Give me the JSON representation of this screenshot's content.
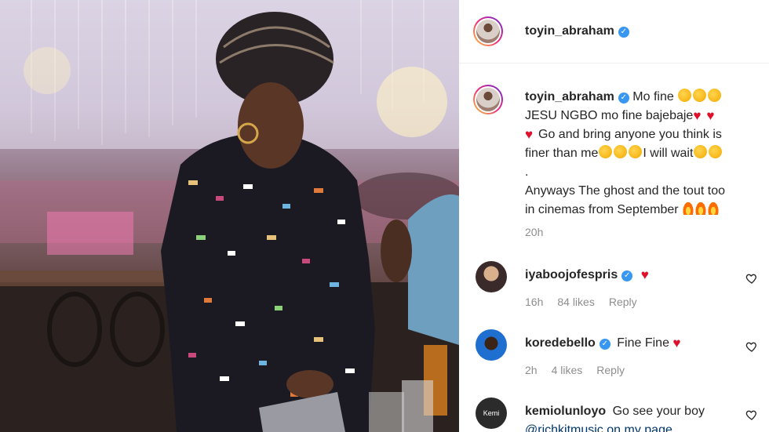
{
  "post": {
    "author": "toyin_abraham",
    "caption_lines": [
      "Mo fine",
      "JESU NGBO mo fine bajebaje",
      "Go and bring anyone you think is",
      "finer than me",
      "I will wait",
      ".",
      "Anyways The ghost and the tout too",
      "in cinemas from September"
    ],
    "time_ago": "20h"
  },
  "comments": [
    {
      "username": "iyaboojofespris",
      "text": "",
      "time": "16h",
      "likes": "84 likes",
      "reply": "Reply",
      "avatar_color": "#3a2a2a"
    },
    {
      "username": "koredebello",
      "text": "Fine Fine",
      "time": "2h",
      "likes": "4 likes",
      "reply": "Reply",
      "avatar_color": "#1f6fd1"
    },
    {
      "username": "kemiolunloyo",
      "text": "Go see your boy",
      "text2": "@richkitmusic on my page",
      "time": "",
      "likes": "",
      "reply": "",
      "avatar_color": "#2b2b2b",
      "avatar_label": "Kemi Talks"
    }
  ],
  "colors": {
    "verified": "#3897f0",
    "heart": "#e0102b",
    "meta": "#8e8e8e"
  },
  "icons": [
    "verified-badge-icon",
    "heart-emoji-icon",
    "like-heart-icon",
    "fire-emoji-icon",
    "face-emoji-icon"
  ]
}
